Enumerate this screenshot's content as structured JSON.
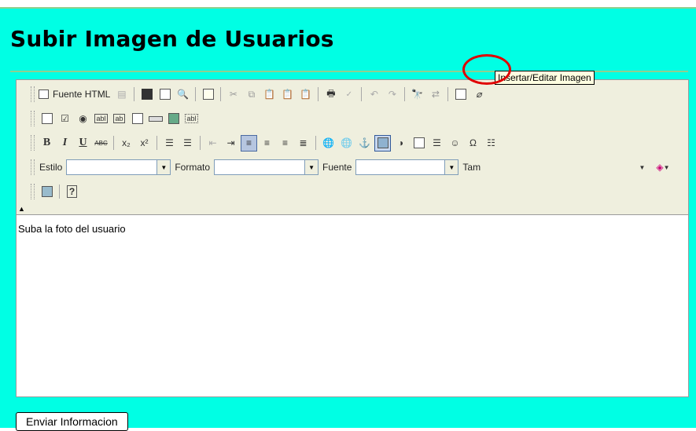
{
  "page": {
    "title": "Subir Imagen de Usuarios"
  },
  "toolbar": {
    "source_label": "Fuente HTML",
    "estilo_label": "Estilo",
    "formato_label": "Formato",
    "fuente_label": "Fuente",
    "tamano_label": "Tam",
    "tooltip": "Insertar/Editar Imagen"
  },
  "editor": {
    "content": "Suba la foto del usuario"
  },
  "form": {
    "submit_label": "Enviar Informacion"
  },
  "colors": {
    "page_bg": "#00ffe4",
    "toolbar_bg": "#efefde",
    "highlight": "#e00000"
  }
}
